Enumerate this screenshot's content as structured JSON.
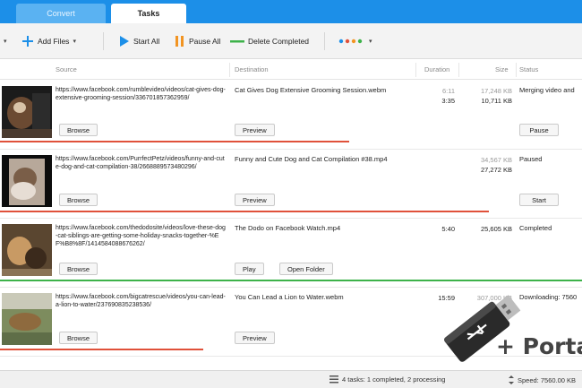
{
  "tabs": [
    {
      "label": "Convert",
      "active": false
    },
    {
      "label": "Tasks",
      "active": true
    }
  ],
  "toolbar": {
    "add_files": "Add Files",
    "start_all": "Start All",
    "pause_all": "Pause All",
    "delete_completed": "Delete Completed"
  },
  "columns": {
    "source": "Source",
    "destination": "Destination",
    "duration": "Duration",
    "size": "Size",
    "status": "Status"
  },
  "tasks": [
    {
      "source_url": "https://www.facebook.com/rumblevideo/videos/cat-gives-dog-extensive-grooming-session/336701857362959/",
      "destination": "Cat Gives Dog Extensive Grooming Session.webm",
      "duration_progress": "6:11",
      "duration": "3:35",
      "size_progress": "17,248 KB",
      "size": "10,711 KB",
      "status": "Merging video and",
      "source_button": "Browse",
      "dest_buttons": [
        "Preview"
      ],
      "action_button": "Pause",
      "progress": 0.6,
      "bar_color": "#e0513a"
    },
    {
      "source_url": "https://www.facebook.com/PurrfectPetz/videos/funny-and-cute-dog-and-cat-compilation-38/2668889573480296/",
      "destination": "Funny and Cute Dog and Cat Compilation #38.mp4",
      "duration_progress": "",
      "duration": "",
      "size_progress": "34,567 KB",
      "size": "27,272 KB",
      "status": "Paused",
      "source_button": "Browse",
      "dest_buttons": [
        "Preview"
      ],
      "action_button": "Start",
      "progress": 0.84,
      "bar_color": "#e0513a"
    },
    {
      "source_url": "https://www.facebook.com/thedodosite/videos/love-these-dog-cat-siblings-are-getting-some-holiday-snacks-together-%EF%B8%8F/1414584088676262/",
      "destination": "The Dodo on Facebook Watch.mp4",
      "duration_progress": "",
      "duration": "5:40",
      "size_progress": "",
      "size": "25,605 KB",
      "status": "Completed",
      "source_button": "Browse",
      "dest_buttons": [
        "Play",
        "Open Folder"
      ],
      "action_button": "",
      "progress": 1.0,
      "bar_color": "#3db24a"
    },
    {
      "source_url": "https://www.facebook.com/bigcatrescue/videos/you-can-lead-a-lion-to-water/237690835238536/",
      "destination": "You Can Lead a Lion to Water.webm",
      "duration_progress": "",
      "duration": "15:59",
      "size_progress": "307,000 KB",
      "size": "",
      "status": "Downloading: 7560",
      "source_button": "Browse",
      "dest_buttons": [
        "Preview"
      ],
      "action_button": "",
      "progress": 0.35,
      "bar_color": "#e0513a"
    }
  ],
  "statusbar": {
    "summary": "4 tasks: 1 completed, 2 processing",
    "speed": "Speed: 7560.00 KB"
  },
  "overlay": {
    "portable": "+ Porta"
  },
  "colors": {
    "accent": "#1c8fe8",
    "progress_red": "#e0513a",
    "progress_green": "#3db24a"
  }
}
